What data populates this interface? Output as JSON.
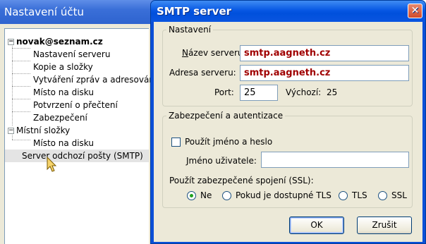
{
  "background_window": {
    "title": "Nastavení účtu",
    "tree": [
      {
        "label": "novak@seznam.cz",
        "level": 0,
        "expanded": true,
        "bold": true
      },
      {
        "label": "Nastavení serveru",
        "level": 1
      },
      {
        "label": "Kopie a složky",
        "level": 1
      },
      {
        "label": "Vytváření zpráv a adresování",
        "level": 1
      },
      {
        "label": "Místo na disku",
        "level": 1
      },
      {
        "label": "Potvrzení o přečtení",
        "level": 1
      },
      {
        "label": "Zabezpečení",
        "level": 1
      },
      {
        "label": "Místní složky",
        "level": 0,
        "expanded": true
      },
      {
        "label": "Místo na disku",
        "level": 1
      },
      {
        "label": "Server odchozí pošty (SMTP)",
        "level": 0,
        "selected": true
      }
    ]
  },
  "dialog": {
    "title": "SMTP server",
    "close_glyph": "✕",
    "settings_group": {
      "legend": "Nastavení",
      "server_name_label": "Název serveru",
      "server_name_value": "smtp.aagneth.cz",
      "server_address_label": "Adresa serveru:",
      "server_address_value": "smtp.aagneth.cz",
      "port_label": "Port:",
      "port_value": "25",
      "default_label": "Výchozí:",
      "default_value": "25"
    },
    "security_group": {
      "legend": "Zabezpečení a autentizace",
      "use_credentials_label": "Použít jméno a heslo",
      "use_credentials_checked": false,
      "username_label": "Jméno uživatele:",
      "username_value": "",
      "ssl_label": "Použít zabezpečené spojení (SSL):",
      "ssl_options": [
        {
          "label": "Ne",
          "selected": true
        },
        {
          "label": "Pokud je dostupné TLS",
          "selected": false
        },
        {
          "label": "TLS",
          "selected": false
        },
        {
          "label": "SSL",
          "selected": false
        }
      ]
    },
    "ok_label": "OK",
    "cancel_label": "Zrušit"
  },
  "colors": {
    "titlebar": "#0858e4",
    "dialog_bg": "#ece9d8",
    "value_text": "#a00000",
    "radio_selected": "#21a121"
  },
  "icons": {
    "tree_expander": "minus-box-icon",
    "close": "close-icon",
    "cursor": "mouse-pointer-icon"
  }
}
